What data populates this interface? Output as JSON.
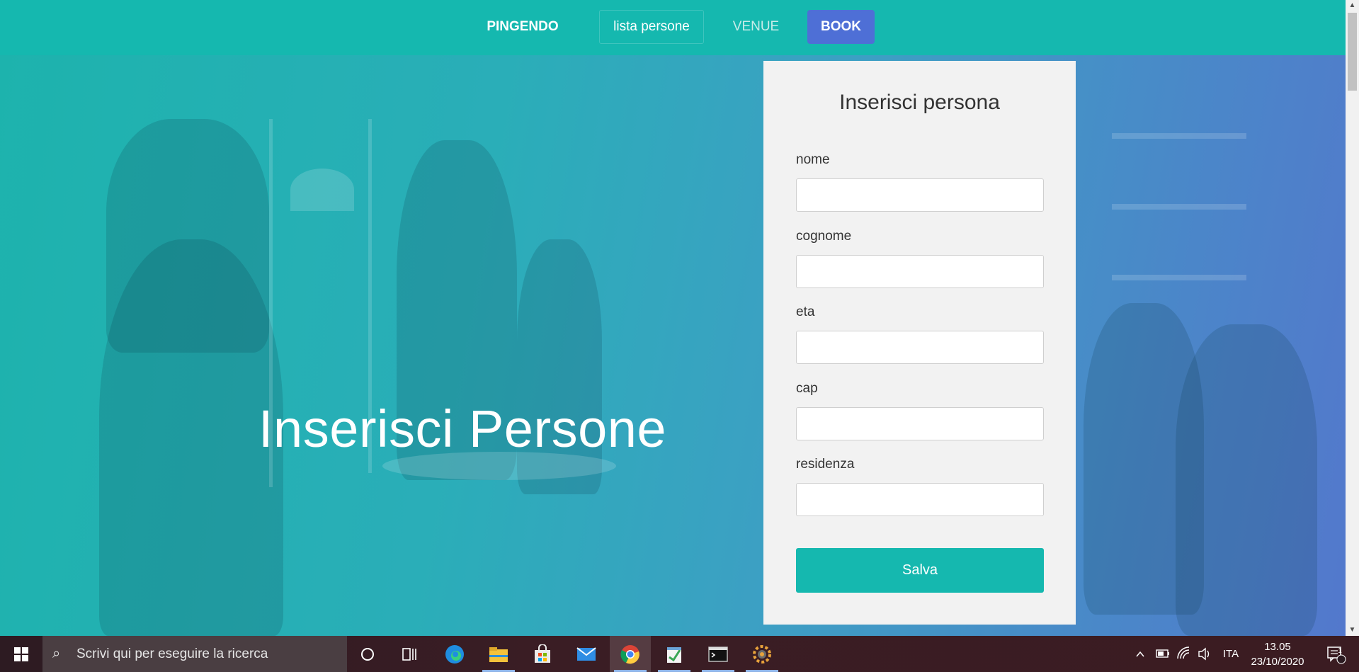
{
  "navbar": {
    "brand": "PINGENDO",
    "link_lista": "lista persone",
    "link_venue": "VENUE",
    "button_book": "BOOK"
  },
  "hero": {
    "title": "Inserisci Persone"
  },
  "form": {
    "title": "Inserisci persona",
    "fields": [
      {
        "label": "nome",
        "value": ""
      },
      {
        "label": "cognome",
        "value": ""
      },
      {
        "label": "eta",
        "value": ""
      },
      {
        "label": "cap",
        "value": ""
      },
      {
        "label": "residenza",
        "value": ""
      }
    ],
    "submit_label": "Salva"
  },
  "taskbar": {
    "search_placeholder": "Scrivi qui per eseguire la ricerca",
    "language": "ITA",
    "time": "13.05",
    "date": "23/10/2020",
    "notification_count": "1",
    "pinned_apps": [
      "cortana-icon",
      "task-view-icon",
      "edge-icon",
      "file-explorer-icon",
      "store-icon",
      "mail-icon",
      "chrome-icon",
      "notepad-icon",
      "terminal-icon",
      "settings-icon"
    ]
  },
  "colors": {
    "navbar": "#15b8af",
    "book_button": "#4e6fd6",
    "save_button": "#15b8af"
  }
}
